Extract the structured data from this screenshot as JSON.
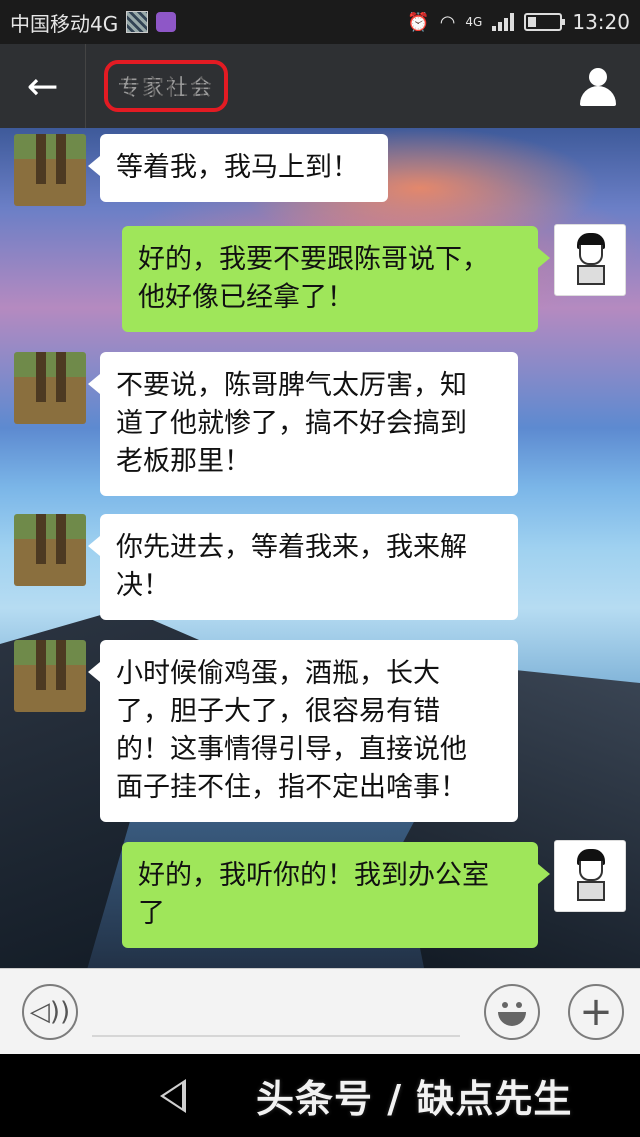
{
  "status_bar": {
    "carrier": "中国移动4G",
    "network": "4G",
    "time": "13:20"
  },
  "nav": {
    "back_icon": "arrow-left-icon",
    "title": "专家社会",
    "profile_icon": "person-icon"
  },
  "messages": [
    {
      "side": "left",
      "text": "等着我，我马上到！"
    },
    {
      "side": "right",
      "text": "好的，我要不要跟陈哥说下，\n他好像已经拿了！"
    },
    {
      "side": "left",
      "text": "不要说，陈哥脾气太厉害，知\n道了他就惨了，搞不好会搞到\n老板那里！"
    },
    {
      "side": "left",
      "text": "你先进去，等着我来，我来解\n决！"
    },
    {
      "side": "left",
      "text": "小时候偷鸡蛋，酒瓶，长大\n了，胆子大了，很容易有错\n的！这事情得引导，直接说他\n面子挂不住，指不定出啥事！"
    },
    {
      "side": "right",
      "text": "好的，我听你的！我到办公室\n了"
    }
  ],
  "input_bar": {
    "voice_icon": "voice-icon",
    "emoji_icon": "emoji-icon",
    "plus_icon": "plus-icon"
  },
  "system_bar": {
    "watermark": "头条号 / 缺点先生"
  },
  "colors": {
    "accent_green": "#9fe65a",
    "nav_bg": "#2e3033",
    "title_border": "#e31b23"
  }
}
